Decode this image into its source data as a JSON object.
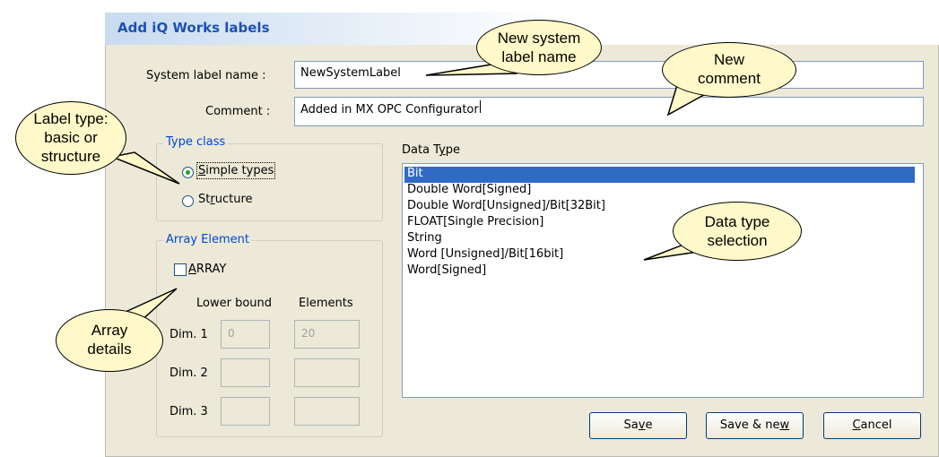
{
  "window": {
    "title": "Add iQ Works labels"
  },
  "form": {
    "system_label_name": {
      "label": "System label name :",
      "value": "NewSystemLabel"
    },
    "comment": {
      "label": "Comment :",
      "value": "Added in MX OPC Configurator"
    }
  },
  "type_class": {
    "title": "Type class",
    "options": [
      {
        "prefix": "",
        "accel": "S",
        "rest": "imple types",
        "selected": true
      },
      {
        "prefix": "St",
        "accel": "r",
        "rest": "ucture",
        "selected": false
      }
    ]
  },
  "array_element": {
    "title": "Array Element",
    "checkbox": {
      "accel": "A",
      "rest": "RRAY",
      "checked": false
    },
    "col_lower": "Lower bound",
    "col_elements": "Elements",
    "dims": [
      {
        "label": "Dim. 1",
        "lower": "0",
        "elements": "20"
      },
      {
        "label": "Dim. 2",
        "lower": "",
        "elements": ""
      },
      {
        "label": "Dim. 3",
        "lower": "",
        "elements": ""
      }
    ]
  },
  "data_type": {
    "label_prefix": "Data T",
    "label_accel": "y",
    "label_rest": "pe",
    "items": [
      "Bit",
      "Double Word[Signed]",
      "Double Word[Unsigned]/Bit[32Bit]",
      "FLOAT[Single Precision]",
      "String",
      "Word [Unsigned]/Bit[16bit]",
      "Word[Signed]"
    ],
    "selected_index": 0
  },
  "buttons": {
    "save": {
      "prefix": "Sa",
      "accel": "v",
      "rest": "e"
    },
    "save_new": {
      "prefix": "Save & ne",
      "accel": "w",
      "rest": ""
    },
    "cancel": {
      "prefix": "",
      "accel": "C",
      "rest": "ancel"
    }
  },
  "callouts": {
    "system_label": [
      "New system",
      "label name"
    ],
    "comment": [
      "New",
      "comment"
    ],
    "label_type": [
      "Label type:",
      "basic or",
      "structure"
    ],
    "data_type": [
      "Data type",
      "selection"
    ],
    "array": [
      "Array",
      "details"
    ]
  },
  "colors": {
    "window_bg": "#ece9d8",
    "title_text": "#1d52b0",
    "group_title": "#0046d5",
    "selection": "#316ac5",
    "callout_fill": "#fff8c8"
  }
}
